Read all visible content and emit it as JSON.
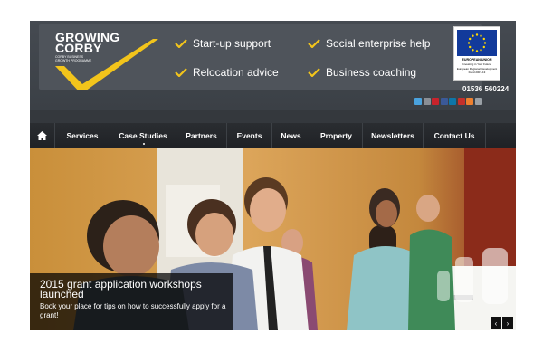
{
  "brand": {
    "line1": "GROWING",
    "line2": "CORBY",
    "tagline1": "CORBY BUSINESS",
    "tagline2": "GROWTH PROGRAMME",
    "accent": "#f2c41b"
  },
  "header_services": [
    {
      "label": "Start-up support"
    },
    {
      "label": "Social enterprise help"
    },
    {
      "label": "Relocation advice"
    },
    {
      "label": "Business coaching"
    }
  ],
  "eu": {
    "title": "EUROPEAN UNION",
    "subtitle": "Investing in Your Future",
    "fund": "European Regional Development Fund 2007-13",
    "flag_color": "#123a9b"
  },
  "phone": "01536 560224",
  "social_icons": [
    "twitter-icon",
    "google-plus-icon",
    "pinterest-icon",
    "facebook-icon",
    "linkedin-icon",
    "youtube-icon",
    "rss-icon",
    "email-icon"
  ],
  "nav": {
    "home_icon": "home-icon",
    "items": [
      {
        "label": "Services"
      },
      {
        "label": "Case Studies"
      },
      {
        "label": "Partners"
      },
      {
        "label": "Events"
      },
      {
        "label": "News"
      },
      {
        "label": "Property"
      },
      {
        "label": "Newsletters"
      },
      {
        "label": "Contact Us"
      }
    ]
  },
  "slide": {
    "title": "2015 grant application workshops launched",
    "text": "Book your place for tips on how to successfully apply for a grant!",
    "prev_icon": "‹",
    "next_icon": "›"
  }
}
